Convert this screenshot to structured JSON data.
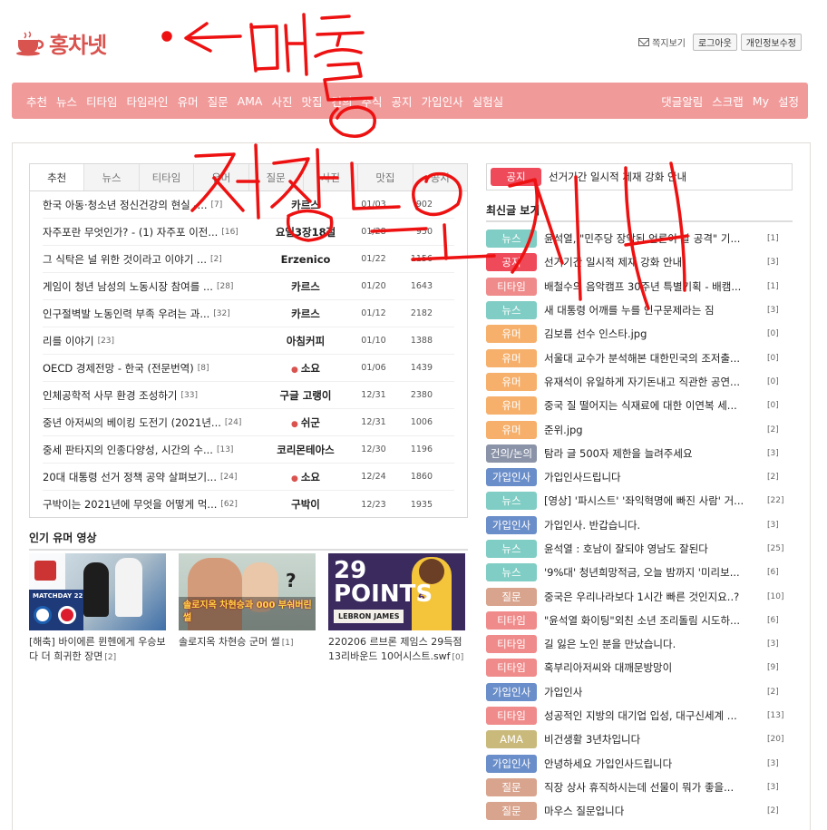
{
  "header": {
    "logo_text": "홍차넷",
    "message_link": "쪽지보기",
    "logout_button": "로그아웃",
    "edit_profile_button": "개인정보수정"
  },
  "nav": {
    "left": [
      "추천",
      "뉴스",
      "티타임",
      "타임라인",
      "유머",
      "질문",
      "AMA",
      "사진",
      "맛집",
      "건의",
      "주식",
      "공지",
      "가입인사",
      "실험실"
    ],
    "right": [
      "댓글알림",
      "스크랩",
      "My",
      "설정"
    ]
  },
  "tabs": [
    "추천",
    "뉴스",
    "티타임",
    "유머",
    "질문",
    "사진",
    "맛집",
    "공지"
  ],
  "posts": [
    {
      "title": "한국 아동·청소년 정신건강의 현실 -...",
      "comments": "[7]",
      "author": "카르스",
      "dot": false,
      "date": "01/03",
      "views": "902"
    },
    {
      "title": "자주포란 무엇인가? - (1) 자주포 이전...",
      "comments": "[16]",
      "author": "요일3장18절",
      "dot": false,
      "date": "01/28",
      "views": "950"
    },
    {
      "title": "그 식탁은 널 위한 것이라고 이야기 ...",
      "comments": "[2]",
      "author": "Erzenico",
      "dot": false,
      "date": "01/22",
      "views": "1156"
    },
    {
      "title": "게임이 청년 남성의 노동시장 참여를 ...",
      "comments": "[28]",
      "author": "카르스",
      "dot": false,
      "date": "01/20",
      "views": "1643"
    },
    {
      "title": "인구절벽발 노동인력 부족 우려는 과...",
      "comments": "[32]",
      "author": "카르스",
      "dot": false,
      "date": "01/12",
      "views": "2182"
    },
    {
      "title": "리를 이야기",
      "comments": "[23]",
      "author": "아침커피",
      "dot": false,
      "date": "01/10",
      "views": "1388"
    },
    {
      "title": "OECD 경제전망 - 한국 (전문번역)",
      "comments": "[8]",
      "author": "소요",
      "dot": true,
      "date": "01/06",
      "views": "1439"
    },
    {
      "title": "인체공학적 사무 환경 조성하기",
      "comments": "[33]",
      "author": "구글 고랭이",
      "dot": false,
      "date": "12/31",
      "views": "2380"
    },
    {
      "title": "중년 아저씨의 베이킹 도전기 (2021년...",
      "comments": "[24]",
      "author": "쉬군",
      "dot": true,
      "date": "12/31",
      "views": "1006"
    },
    {
      "title": "중세 판타지의 인종다양성, 시간의 수...",
      "comments": "[13]",
      "author": "코리몬테아스",
      "dot": false,
      "date": "12/30",
      "views": "1196"
    },
    {
      "title": "20대 대통령 선거 정책 공약 살펴보기...",
      "comments": "[24]",
      "author": "소요",
      "dot": true,
      "date": "12/24",
      "views": "1860"
    },
    {
      "title": "구박이는 2021년에 무엇을 어떻게 먹...",
      "comments": "[62]",
      "author": "구박이",
      "dot": false,
      "date": "12/23",
      "views": "1935"
    }
  ],
  "videos_section": {
    "title": "인기 유머 영상",
    "items": [
      {
        "caption": "[해축] 바이에른 뮌헨에게 우승보다 더 희귀한 장면",
        "comments": "[2]",
        "thumb_text": "MATCHDAY 22"
      },
      {
        "caption": "솔로지옥 차현승 군머 썰",
        "comments": "[1]",
        "thumb_text": "솔로지옥 차현승과 000 부숴버린 썰"
      },
      {
        "caption": "220206 르브론 제임스 29득점 13리바운드 10어시스트.swf",
        "comments": "[0]",
        "thumb_text": "29 POINTS",
        "thumb_sub": "LEBRON JAMES"
      }
    ]
  },
  "notice": {
    "badge": "공지",
    "text": "선거기간 일시적 제재 강화 안내"
  },
  "latest": {
    "title": "최신글 보기",
    "items": [
      {
        "badge": "뉴스",
        "color": "#7fcdc4",
        "title": "윤석열, \"민주당 장악된 언론이 날 공격\" 기...",
        "comments": "[1]"
      },
      {
        "badge": "공지",
        "color": "#ef4a5a",
        "title": "선거기간 일시적 제재 강화 안내",
        "comments": "[3]"
      },
      {
        "badge": "티타임",
        "color": "#f08b8b",
        "title": "배철수의 음악캠프 30주년 특별기획 - 배캠...",
        "comments": "[1]"
      },
      {
        "badge": "뉴스",
        "color": "#7fcdc4",
        "title": "새 대통령 어깨를 누를 인구문제라는 짐",
        "comments": "[3]"
      },
      {
        "badge": "유머",
        "color": "#f6b06b",
        "title": "김보름 선수 인스타.jpg",
        "comments": "[0]"
      },
      {
        "badge": "유머",
        "color": "#f6b06b",
        "title": "서울대 교수가 분석해본 대한민국의 조저출...",
        "comments": "[0]"
      },
      {
        "badge": "유머",
        "color": "#f6b06b",
        "title": "유재석이 유일하게 자기돈내고 직관한 공연...",
        "comments": "[0]"
      },
      {
        "badge": "유머",
        "color": "#f6b06b",
        "title": "중국 질 떨어지는 식재료에 대한 이연복 세...",
        "comments": "[0]"
      },
      {
        "badge": "유머",
        "color": "#f6b06b",
        "title": "준위.jpg",
        "comments": "[2]"
      },
      {
        "badge": "건의/논의",
        "color": "#8a93a8",
        "title": "탐라 글 500자 제한을 늘려주세요",
        "comments": "[3]"
      },
      {
        "badge": "가입인사",
        "color": "#6a8ec9",
        "title": "가입인사드립니다",
        "comments": "[2]"
      },
      {
        "badge": "뉴스",
        "color": "#7fcdc4",
        "title": "[영상] '파시스트' '좌익혁명에 빠진 사람' 거...",
        "comments": "[22]"
      },
      {
        "badge": "가입인사",
        "color": "#6a8ec9",
        "title": "가입인사. 반갑습니다.",
        "comments": "[3]"
      },
      {
        "badge": "뉴스",
        "color": "#7fcdc4",
        "title": "윤석열 : 호남이 잘되야 영남도 잘된다",
        "comments": "[25]"
      },
      {
        "badge": "뉴스",
        "color": "#7fcdc4",
        "title": "'9%대' 청년희망적금, 오늘 밤까지 '미리보...",
        "comments": "[6]"
      },
      {
        "badge": "질문",
        "color": "#d9a48e",
        "title": "중국은 우리나라보다 1시간 빠른 것인지요..?",
        "comments": "[10]"
      },
      {
        "badge": "티타임",
        "color": "#f08b8b",
        "title": "\"윤석열 화이팅\"외친 소년 조리돌림 시도하...",
        "comments": "[6]"
      },
      {
        "badge": "티타임",
        "color": "#f08b8b",
        "title": "길 잃은 노인 분을 만났습니다.",
        "comments": "[3]"
      },
      {
        "badge": "티타임",
        "color": "#f08b8b",
        "title": "혹부리아저씨와 대깨문방망이",
        "comments": "[9]"
      },
      {
        "badge": "가입인사",
        "color": "#6a8ec9",
        "title": "가입인사",
        "comments": "[2]"
      },
      {
        "badge": "티타임",
        "color": "#f08b8b",
        "title": "성공적인 지방의 대기업 입성, 대구신세계 ...",
        "comments": "[13]"
      },
      {
        "badge": "AMA",
        "color": "#c9b97a",
        "title": "비건생활 3년차입니다",
        "comments": "[20]"
      },
      {
        "badge": "가입인사",
        "color": "#6a8ec9",
        "title": "안녕하세요 가입인사드립니다",
        "comments": "[3]"
      },
      {
        "badge": "질문",
        "color": "#d9a48e",
        "title": "직장 상사 휴직하시는데 선물이 뭐가 좋을...",
        "comments": "[3]"
      },
      {
        "badge": "질문",
        "color": "#d9a48e",
        "title": "마우스 질문입니다",
        "comments": "[2]"
      }
    ]
  },
  "colors": {
    "brand": "#d9534f",
    "nav_bg": "#f19a9a",
    "annotation": "#ee1111"
  }
}
